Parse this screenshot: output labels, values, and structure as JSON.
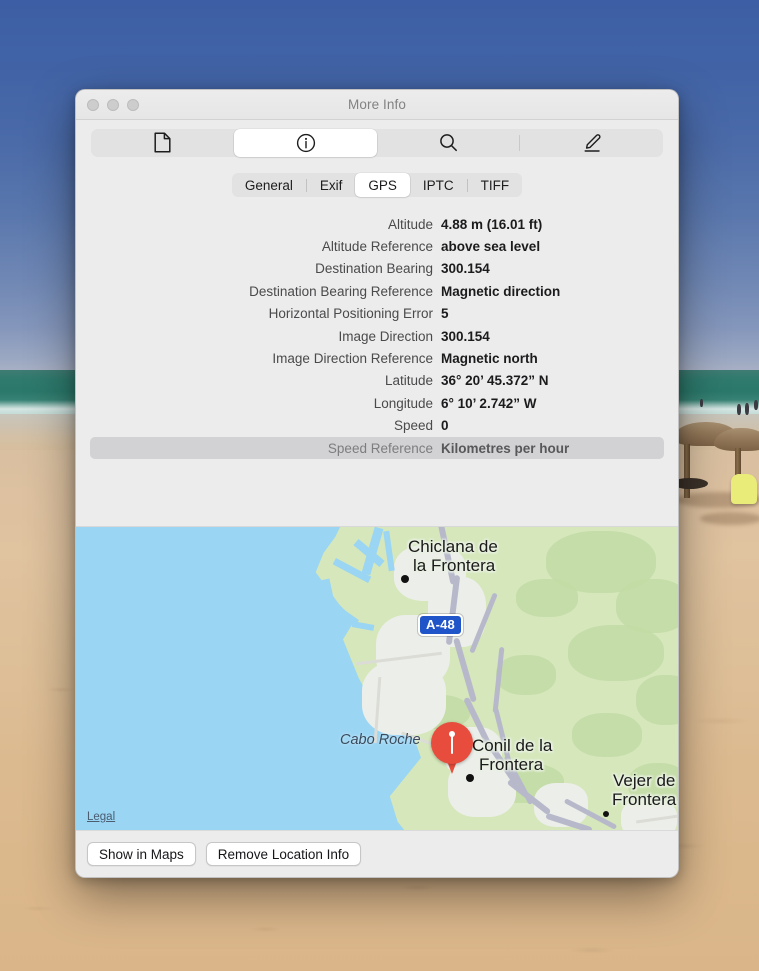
{
  "window": {
    "title": "More Info",
    "traffic_lights": [
      "close-button",
      "minimize-button",
      "zoom-button"
    ]
  },
  "toolbar": {
    "items": [
      {
        "name": "document-icon",
        "label": "Document",
        "selected": false
      },
      {
        "name": "info-icon",
        "label": "Info",
        "selected": true
      },
      {
        "name": "search-icon",
        "label": "Search",
        "selected": false
      },
      {
        "name": "markup-pencil-icon",
        "label": "Markup",
        "selected": false
      }
    ]
  },
  "tabs": [
    {
      "label": "General",
      "selected": false
    },
    {
      "label": "Exif",
      "selected": false
    },
    {
      "label": "GPS",
      "selected": true
    },
    {
      "label": "IPTC",
      "selected": false
    },
    {
      "label": "TIFF",
      "selected": false
    }
  ],
  "metadata": {
    "rows": [
      {
        "label": "Altitude",
        "value": "4.88 m (16.01 ft)",
        "selected": false
      },
      {
        "label": "Altitude Reference",
        "value": "above sea level",
        "selected": false
      },
      {
        "label": "Destination Bearing",
        "value": "300.154",
        "selected": false
      },
      {
        "label": "Destination Bearing Reference",
        "value": "Magnetic direction",
        "selected": false
      },
      {
        "label": "Horizontal Positioning Error",
        "value": "5",
        "selected": false
      },
      {
        "label": "Image Direction",
        "value": "300.154",
        "selected": false
      },
      {
        "label": "Image Direction Reference",
        "value": "Magnetic north",
        "selected": false
      },
      {
        "label": "Latitude",
        "value": "36° 20’ 45.372” N",
        "selected": false
      },
      {
        "label": "Longitude",
        "value": "6° 10’ 2.742” W",
        "selected": false
      },
      {
        "label": "Speed",
        "value": "0",
        "selected": false
      },
      {
        "label": "Speed Reference",
        "value": "Kilometres per hour",
        "selected": true
      }
    ]
  },
  "map": {
    "labels": [
      {
        "text": "Chiclana de",
        "type": "city"
      },
      {
        "text": "la Frontera",
        "type": "city"
      },
      {
        "text": "Conil de la",
        "type": "city"
      },
      {
        "text": "Frontera",
        "type": "city"
      },
      {
        "text": "Vejer de",
        "type": "city"
      },
      {
        "text": "Frontera",
        "type": "city"
      },
      {
        "text": "Cabo Roche",
        "type": "water-feature"
      }
    ],
    "road_shield": "A-48",
    "legal_link": "Legal",
    "pin": "location-pin",
    "colors": {
      "ocean": "#9ad5f4",
      "land": "#d3e6b8",
      "forest": "#c2dba4",
      "urban": "#eceee9",
      "road": "#b7b9cb",
      "pin": "#e74c3c",
      "shield": "#1f55c9"
    }
  },
  "actions": {
    "show_in_maps": "Show in Maps",
    "remove_location_info": "Remove Location Info"
  }
}
